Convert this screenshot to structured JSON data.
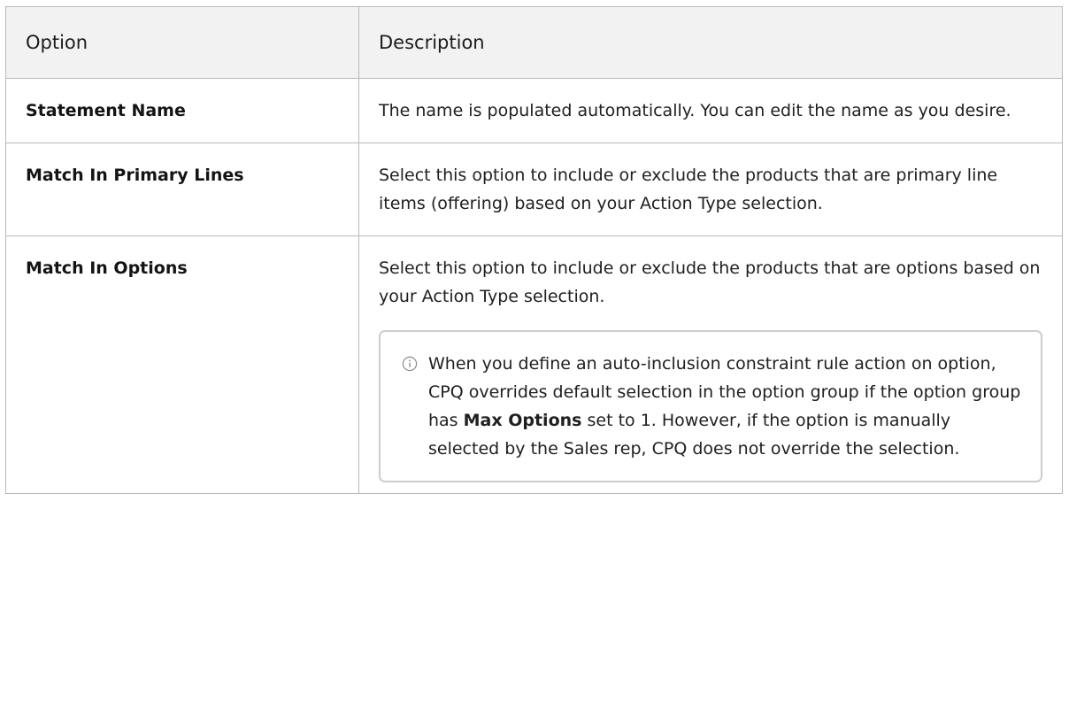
{
  "table": {
    "headers": [
      "Option",
      "Description"
    ],
    "rows": [
      {
        "option": "Statement Name",
        "description": "The name is populated automatically. You can edit the name as you desire."
      },
      {
        "option": "Match In Primary Lines",
        "description": "Select this option to include or exclude the products that are primary line items (offering) based on your Action Type selection."
      },
      {
        "option": "Match In Options",
        "description": "Select this option to include or exclude the products that are options based on your Action Type selection.",
        "note": {
          "icon": "info-icon",
          "part1": "When you define an auto-inclusion constraint rule action on option, CPQ overrides default selection in the option group if the option group has ",
          "bold": "Max Options",
          "part2": " set to 1. However, if the option is manually selected by the Sales rep, CPQ does not override the selection."
        }
      }
    ]
  },
  "colors": {
    "border": "#b9b9b9",
    "header_bg": "#f2f2f2",
    "note_border": "#cdcdcd"
  }
}
